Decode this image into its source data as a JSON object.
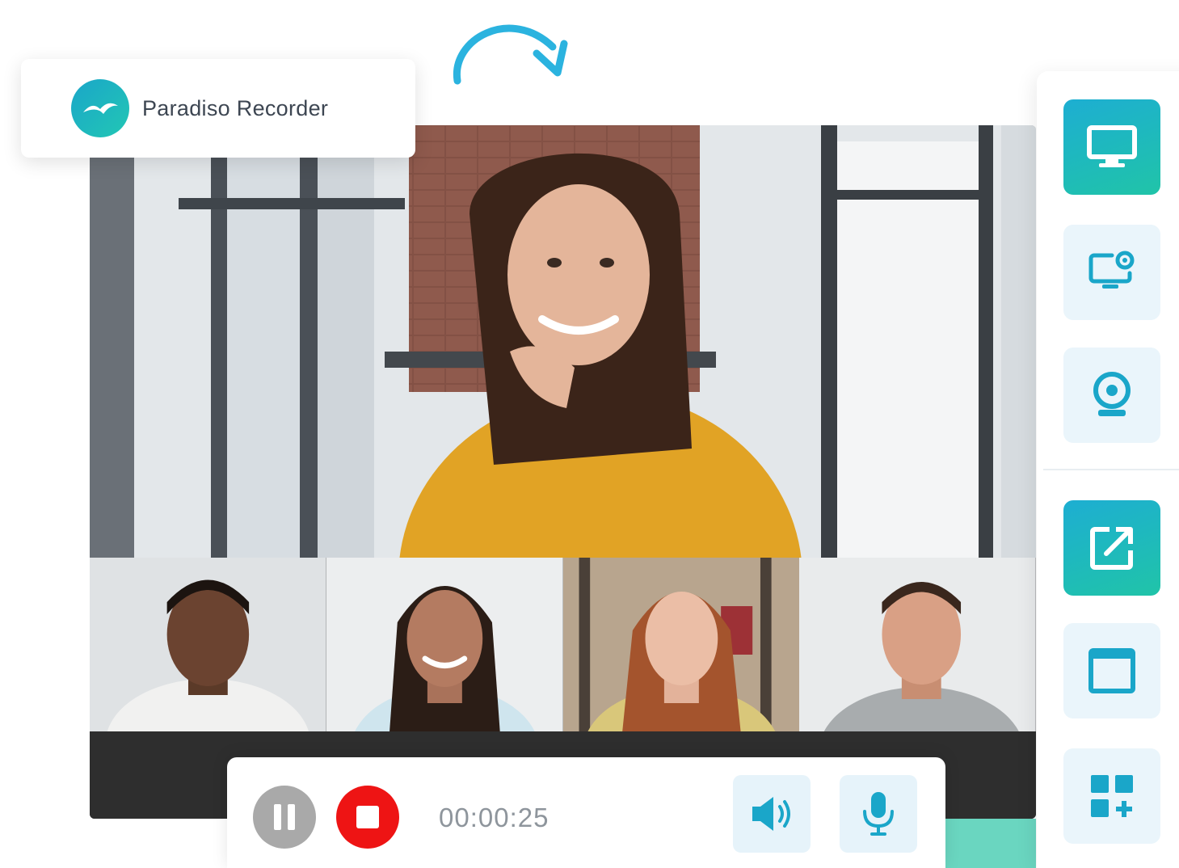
{
  "brand": {
    "name": "Paradiso Recorder",
    "logo_icon": "bird-logo-icon",
    "accent_color": "#1aa6c9"
  },
  "toolbar": {
    "items": [
      {
        "id": "screen",
        "icon": "monitor-icon",
        "active": true
      },
      {
        "id": "screen-camera",
        "icon": "screen-camera-icon",
        "active": false
      },
      {
        "id": "webcam",
        "icon": "webcam-icon",
        "active": false
      },
      {
        "id": "share",
        "icon": "external-link-icon",
        "active": true
      },
      {
        "id": "window",
        "icon": "window-icon",
        "active": false
      },
      {
        "id": "add-widget",
        "icon": "widgets-add-icon",
        "active": false
      }
    ]
  },
  "recording": {
    "timer": "00:00:25",
    "pause_icon": "pause-icon",
    "stop_icon": "stop-icon",
    "speaker_icon": "speaker-icon",
    "mic_icon": "microphone-icon",
    "stop_color": "#ee1414"
  }
}
